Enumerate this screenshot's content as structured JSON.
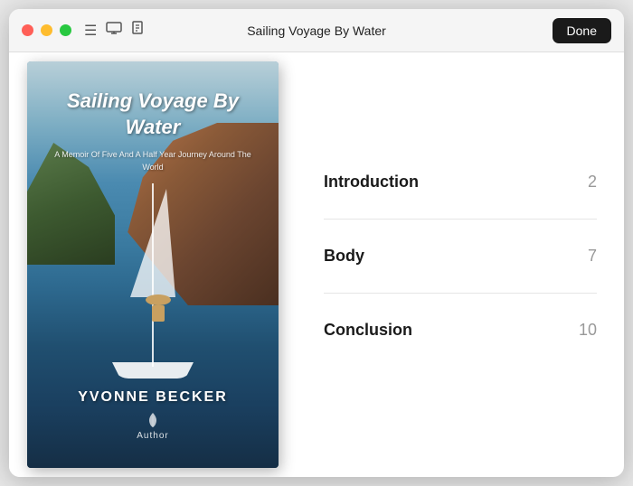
{
  "window": {
    "title": "Sailing Voyage By Water",
    "done_label": "Done"
  },
  "book": {
    "title": "Sailing Voyage By Water",
    "subtitle": "A Memoir Of Five And A Half Year Journey Around The World",
    "author": "YVONNE BECKER",
    "publisher": "Author"
  },
  "toc": {
    "items": [
      {
        "chapter": "Introduction",
        "page": "2"
      },
      {
        "chapter": "Body",
        "page": "7"
      },
      {
        "chapter": "Conclusion",
        "page": "10"
      }
    ]
  },
  "icons": {
    "list": "☰",
    "monitor": "⬜",
    "doc": "📄"
  }
}
